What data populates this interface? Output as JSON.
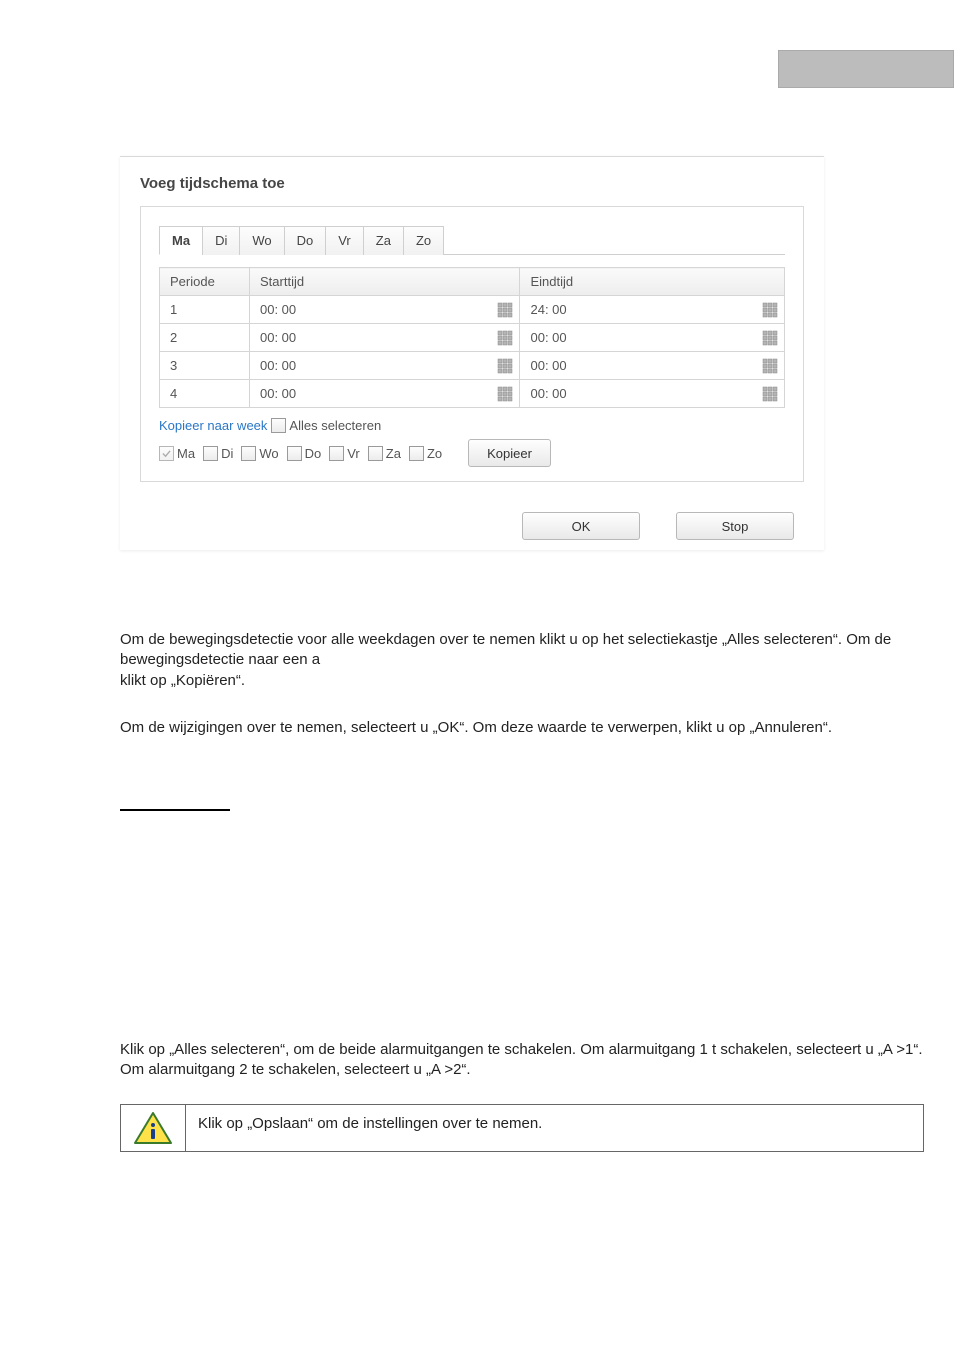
{
  "dialog": {
    "title": "Voeg tijdschema toe",
    "tabs": [
      "Ma",
      "Di",
      "Wo",
      "Do",
      "Vr",
      "Za",
      "Zo"
    ],
    "active_tab": 0,
    "columns": {
      "periode": "Periode",
      "starttijd": "Starttijd",
      "eindtijd": "Eindtijd"
    },
    "rows": [
      {
        "periode": "1",
        "start": "00: 00",
        "end": "24: 00"
      },
      {
        "periode": "2",
        "start": "00: 00",
        "end": "00: 00"
      },
      {
        "periode": "3",
        "start": "00: 00",
        "end": "00: 00"
      },
      {
        "periode": "4",
        "start": "00: 00",
        "end": "00: 00"
      }
    ],
    "copy": {
      "link": "Kopieer naar week",
      "select_all": "Alles selecteren",
      "days": [
        "Ma",
        "Di",
        "Wo",
        "Do",
        "Vr",
        "Za",
        "Zo"
      ],
      "button": "Kopieer"
    },
    "buttons": {
      "ok": "OK",
      "stop": "Stop"
    }
  },
  "paragraphs": {
    "p1": "Om de bewegingsdetectie voor alle weekdagen over te nemen klikt u op het selectiekastje „Alles selecteren“. Om de bewegingsdetectie naar een a\nklikt op „Kopiëren“.",
    "p2": "Om de wijzigingen over te nemen, selecteert u „OK“. Om deze waarde te verwerpen, klikt u op „Annuleren“.",
    "p3": "Klik op „Alles selecteren“, om de beide alarmuitgangen te schakelen.  Om alarmuitgang 1 t schakelen, selecteert u „A >1“. Om alarmuitgang 2 te schakelen, selecteert u „A >2“."
  },
  "note": "Klik op „Opslaan“ om de instellingen over te nemen."
}
